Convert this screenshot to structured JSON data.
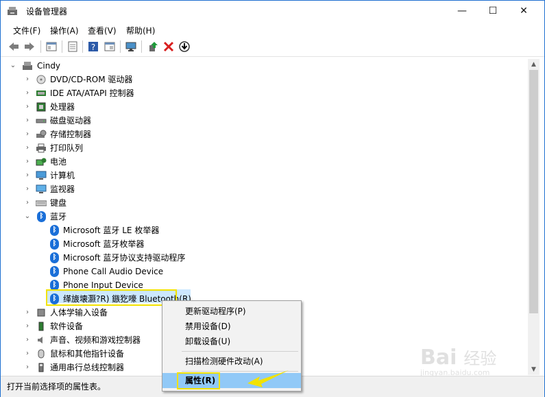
{
  "window": {
    "title": "设备管理器",
    "controls": [
      "—",
      "☐",
      "✕"
    ]
  },
  "menu": [
    "文件(F)",
    "操作(A)",
    "查看(V)",
    "帮助(H)"
  ],
  "tree": {
    "root": "Cindy",
    "categories": [
      {
        "label": "DVD/CD-ROM 驱动器",
        "icon": "disc-drive-icon"
      },
      {
        "label": "IDE ATA/ATAPI 控制器",
        "icon": "ide-controller-icon"
      },
      {
        "label": "处理器",
        "icon": "processor-icon"
      },
      {
        "label": "磁盘驱动器",
        "icon": "disk-drive-icon"
      },
      {
        "label": "存储控制器",
        "icon": "storage-controller-icon"
      },
      {
        "label": "打印队列",
        "icon": "printer-icon"
      },
      {
        "label": "电池",
        "icon": "battery-icon"
      },
      {
        "label": "计算机",
        "icon": "computer-icon"
      },
      {
        "label": "监视器",
        "icon": "monitor-icon"
      },
      {
        "label": "键盘",
        "icon": "keyboard-icon"
      }
    ],
    "bluetooth": {
      "label": "蓝牙",
      "children": [
        "Microsoft 蓝牙 LE 枚举器",
        "Microsoft 蓝牙枚举器",
        "Microsoft 蓝牙协议支持驱动程序",
        "Phone Call Audio Device",
        "Phone Input Device",
        "缂旇壊灏?R) 鏃犵嚎 Bluetooth(R)"
      ]
    },
    "after": [
      {
        "label": "人体学输入设备",
        "icon": "hid-icon"
      },
      {
        "label": "软件设备",
        "icon": "software-device-icon"
      },
      {
        "label": "声音、视频和游戏控制器",
        "icon": "sound-icon"
      },
      {
        "label": "鼠标和其他指针设备",
        "icon": "mouse-icon"
      },
      {
        "label": "通用串行总线控制器",
        "icon": "usb-icon"
      }
    ]
  },
  "context_menu": {
    "items": [
      "更新驱动程序(P)",
      "禁用设备(D)",
      "卸载设备(U)",
      "扫描检测硬件改动(A)",
      "属性(R)"
    ]
  },
  "status": "打开当前选择项的属性表。",
  "watermark": {
    "brand": "Bai",
    "brand2": "经验",
    "url": "jingyan.baidu.com"
  },
  "colors": {
    "accent": "#1a6fd8",
    "highlight": "#f2e200",
    "selection": "#cce8ff"
  }
}
